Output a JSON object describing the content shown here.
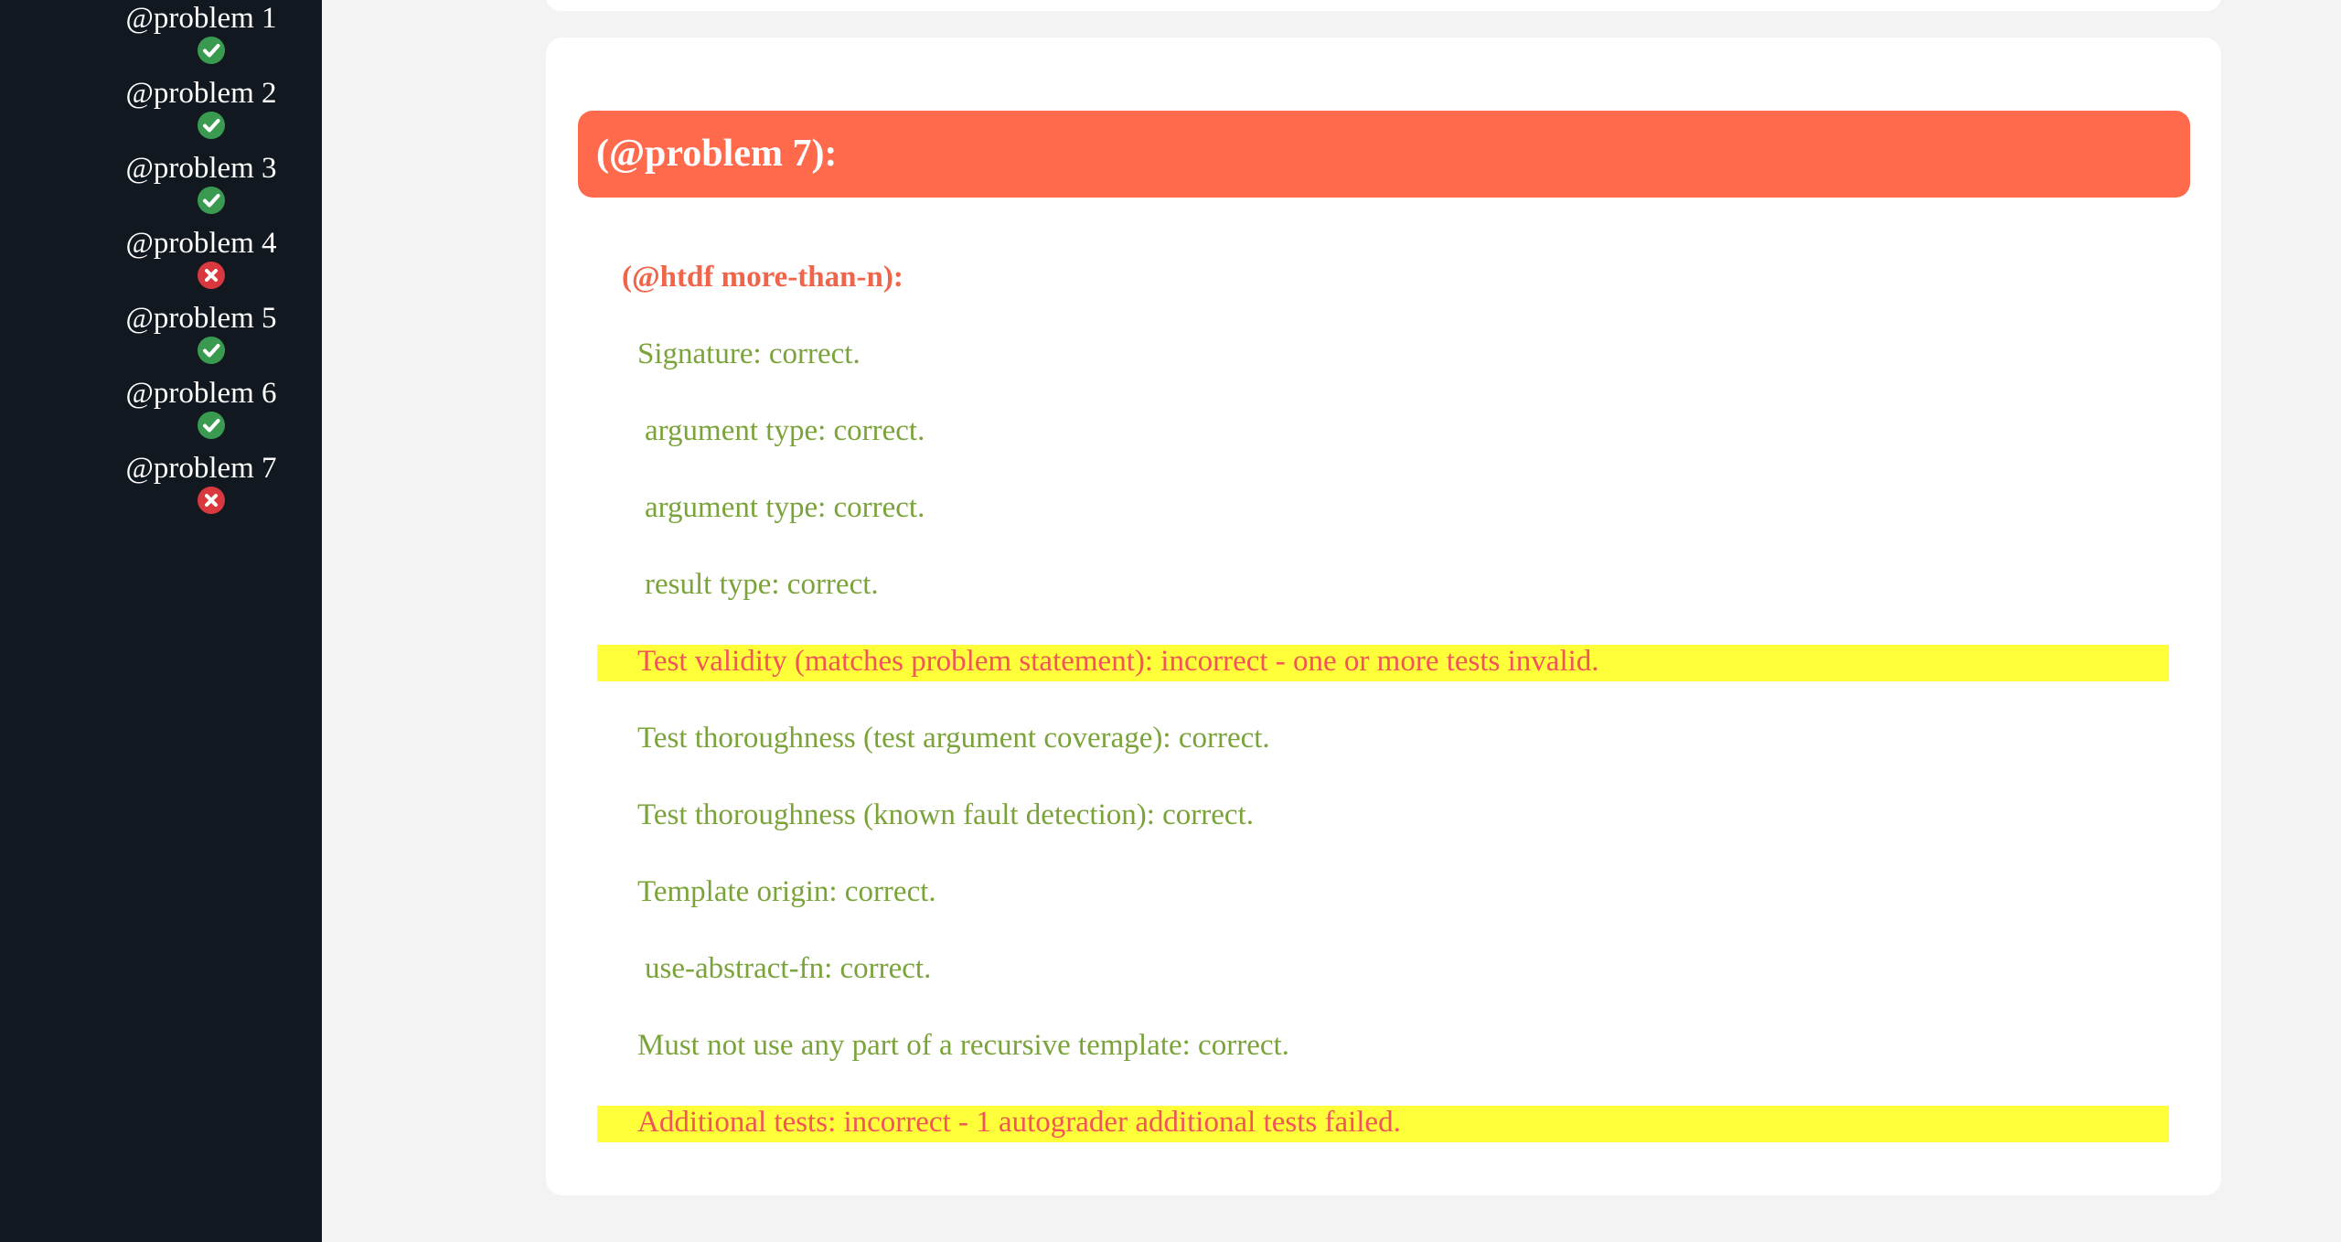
{
  "sidebar": {
    "items": [
      {
        "label": "@problem 1",
        "status": "correct",
        "icon": "check-circle-icon"
      },
      {
        "label": "@problem 2",
        "status": "correct",
        "icon": "check-circle-icon"
      },
      {
        "label": "@problem 3",
        "status": "correct",
        "icon": "check-circle-icon"
      },
      {
        "label": "@problem 4",
        "status": "incorrect",
        "icon": "x-circle-icon"
      },
      {
        "label": "@problem 5",
        "status": "correct",
        "icon": "check-circle-icon"
      },
      {
        "label": "@problem 6",
        "status": "correct",
        "icon": "check-circle-icon"
      },
      {
        "label": "@problem 7",
        "status": "incorrect",
        "icon": "x-circle-icon"
      }
    ]
  },
  "colors": {
    "sidebar_bg": "#111820",
    "header_bg": "#ff6a4d",
    "correct_text": "#7aa33a",
    "incorrect_text": "#f2545a",
    "highlight_bg": "#ffff3a",
    "check_green": "#3a9a4f",
    "x_red": "#d8383e"
  },
  "main": {
    "problem_title": "(@problem 7):",
    "htdf_title": "(@htdf more-than-n):",
    "results": [
      {
        "text": "Signature: correct.",
        "status": "correct"
      },
      {
        "text": "argument type: correct.",
        "status": "correct"
      },
      {
        "text": "argument type: correct.",
        "status": "correct"
      },
      {
        "text": "result type: correct.",
        "status": "correct"
      },
      {
        "text": "Test validity (matches problem statement): incorrect - one or more tests invalid.",
        "status": "incorrect"
      },
      {
        "text": "Test thoroughness (test argument coverage): correct.",
        "status": "correct"
      },
      {
        "text": "Test thoroughness (known fault detection): correct.",
        "status": "correct"
      },
      {
        "text": "Template origin: correct.",
        "status": "correct"
      },
      {
        "text": "use-abstract-fn: correct.",
        "status": "correct"
      },
      {
        "text": "Must not use any part of a recursive template: correct.",
        "status": "correct"
      },
      {
        "text": "Additional tests: incorrect - 1 autograder additional tests failed.",
        "status": "incorrect"
      }
    ]
  }
}
